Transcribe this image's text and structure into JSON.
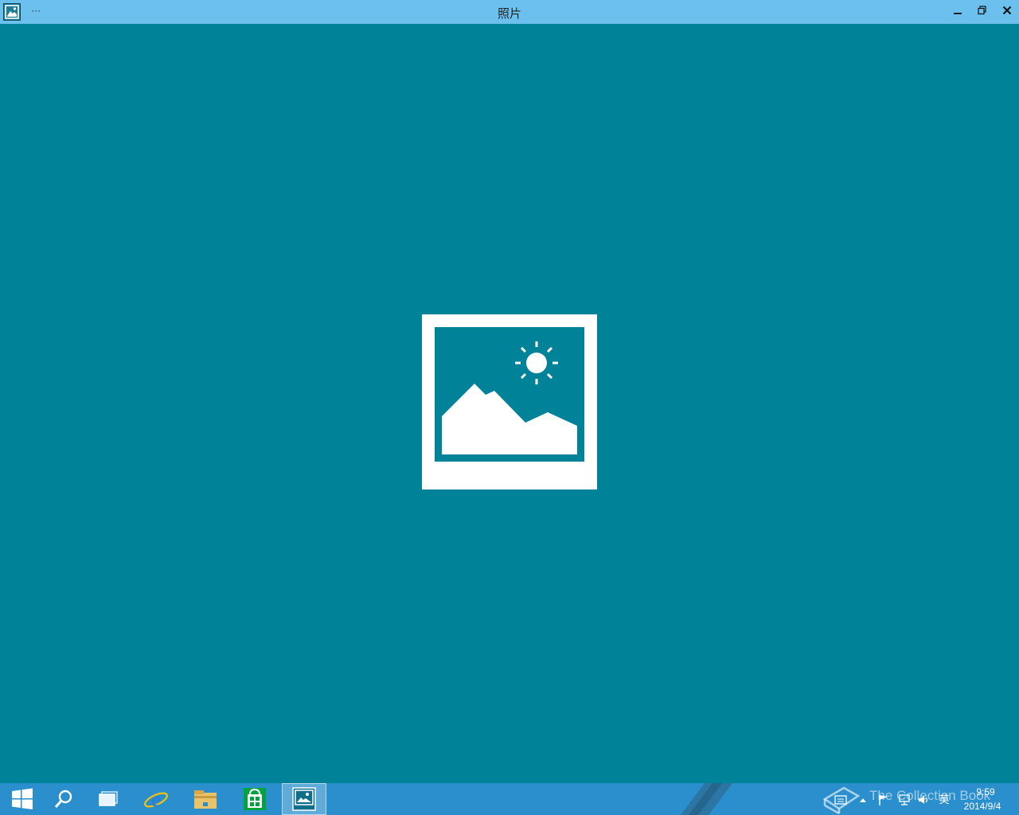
{
  "window": {
    "title": "照片",
    "more_label": "···",
    "minimize_icon": "minimize-icon",
    "maximize_icon": "restore-icon",
    "close_icon": "close-icon"
  },
  "main": {
    "background_color": "#008299",
    "placeholder_icon": "photo-placeholder-icon"
  },
  "taskbar": {
    "color": "#2a8fcc",
    "items": [
      {
        "name": "start",
        "icon": "windows-logo-icon"
      },
      {
        "name": "search",
        "icon": "search-icon"
      },
      {
        "name": "task-view",
        "icon": "task-view-icon"
      },
      {
        "name": "internet-explorer",
        "icon": "ie-icon"
      },
      {
        "name": "file-explorer",
        "icon": "folder-icon"
      },
      {
        "name": "store",
        "icon": "store-icon"
      },
      {
        "name": "photos",
        "icon": "photos-icon",
        "active": true
      }
    ],
    "tray": {
      "ime_label": "英",
      "time": "9:59",
      "date": "2014/9/4"
    }
  },
  "watermark": {
    "text": "The Collection Book"
  }
}
